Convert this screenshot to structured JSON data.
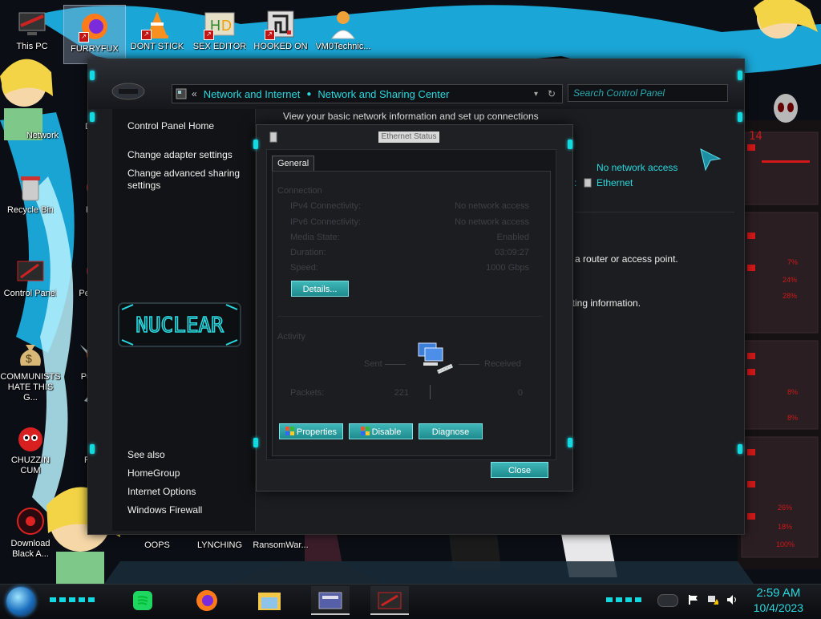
{
  "desktop": {
    "icons_top": [
      {
        "label": "This PC"
      },
      {
        "label": "FURRYFUX"
      },
      {
        "label": "DONT STICK"
      },
      {
        "label": "SEX EDITOR"
      },
      {
        "label": "HOOKED ON"
      },
      {
        "label": "VM0Technic..."
      }
    ],
    "icons_left": [
      {
        "label": "Network"
      },
      {
        "label": "Recycle Bin"
      },
      {
        "label": "Control Panel"
      },
      {
        "label": "COMMUNISTS HATE THIS G..."
      },
      {
        "label": "CHUZZIN CUM"
      },
      {
        "label": "Download Black A..."
      }
    ],
    "icons_col2": [
      {
        "label": "D DUM"
      },
      {
        "label": "Peggle"
      },
      {
        "label": "Peggle De"
      },
      {
        "label": "Peggle of Wa"
      },
      {
        "label": "Plan Zo"
      }
    ],
    "icons_bottom": [
      {
        "label": "OOPS"
      },
      {
        "label": "LYNCHING"
      },
      {
        "label": "RansomWar..."
      }
    ]
  },
  "control_panel": {
    "breadcrumb": [
      "Network and Internet",
      "Network and Sharing Center"
    ],
    "search_placeholder": "Search Control Panel",
    "sidebar": {
      "home": "Control Panel Home",
      "links": [
        "Change adapter settings",
        "Change advanced sharing settings"
      ],
      "logo_text": "NUCLEAR",
      "see_also_title": "See also",
      "see_also": [
        "HomeGroup",
        "Internet Options",
        "Windows Firewall"
      ]
    },
    "heading": "View your basic network information and set up connections",
    "access_type": "No network access",
    "connections_label": ":",
    "connection_name": "Ethernet",
    "router_text": "o a router or access point.",
    "troubleshoot_text": "oting information."
  },
  "ethernet_status": {
    "title": "Ethernet Status",
    "tab": "General",
    "connection_section": "Connection",
    "rows": [
      {
        "label": "IPv4 Connectivity:",
        "value": "No network access"
      },
      {
        "label": "IPv6 Connectivity:",
        "value": "No network access"
      },
      {
        "label": "Media State:",
        "value": "Enabled"
      },
      {
        "label": "Duration:",
        "value": "03:09:27"
      },
      {
        "label": "Speed:",
        "value": "1000 Gbps"
      }
    ],
    "details_button": "Details...",
    "activity_section": "Activity",
    "sent_label": "Sent",
    "received_label": "Received",
    "packets_label": "Packets:",
    "packets_sent": "221",
    "packets_received": "0",
    "properties_button": "Properties",
    "disable_button": "Disable",
    "diagnose_button": "Diagnose",
    "close_button": "Close"
  },
  "taskbar": {
    "pinned": [
      "spotify-icon",
      "firefox-icon",
      "file-explorer-icon",
      "control-panel-icon",
      "ransomware-icon"
    ],
    "time": "2:59 AM",
    "date": "10/4/2023"
  },
  "sidebar_gauge_text": {
    "top": "14",
    "pct": [
      "7%",
      "24%",
      "28%",
      "8%",
      "8%",
      "26%",
      "18%",
      "100%"
    ]
  },
  "colors": {
    "accent": "#29d9df",
    "window_bg": "#1b1d21",
    "button": "#2aa3a5"
  }
}
